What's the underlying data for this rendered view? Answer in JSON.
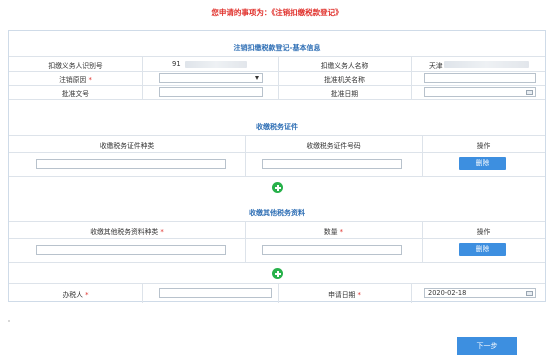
{
  "header": {
    "title": "您申请的事项为：《注销扣缴税款登记》"
  },
  "basic": {
    "section_title": "注销扣缴税款登记-基本信息",
    "withholder_id_label": "扣缴义务人识别号",
    "withholder_id_value": "91",
    "withholder_name_label": "扣缴义务人名称",
    "withholder_name_value": "天津",
    "cancel_reason_label": "注销原因",
    "approval_org_label": "批准机关名称",
    "approval_doc_label": "批准文号",
    "approval_date_label": "批准日期",
    "required_mark": "*"
  },
  "certificates": {
    "section_title": "收缴税务证件",
    "col_type": "收缴税务证件种类",
    "col_number": "收缴税务证件号码",
    "col_action": "操作",
    "delete_label": "删除"
  },
  "materials": {
    "section_title": "收缴其他税务资料",
    "col_type": "收缴其他税务资料种类",
    "col_quantity": "数量",
    "col_action": "操作",
    "delete_label": "删除"
  },
  "footer_row": {
    "handler_label": "办税人",
    "apply_date_label": "申请日期",
    "apply_date_value": "2020-02-18"
  },
  "next_button": "下一步"
}
